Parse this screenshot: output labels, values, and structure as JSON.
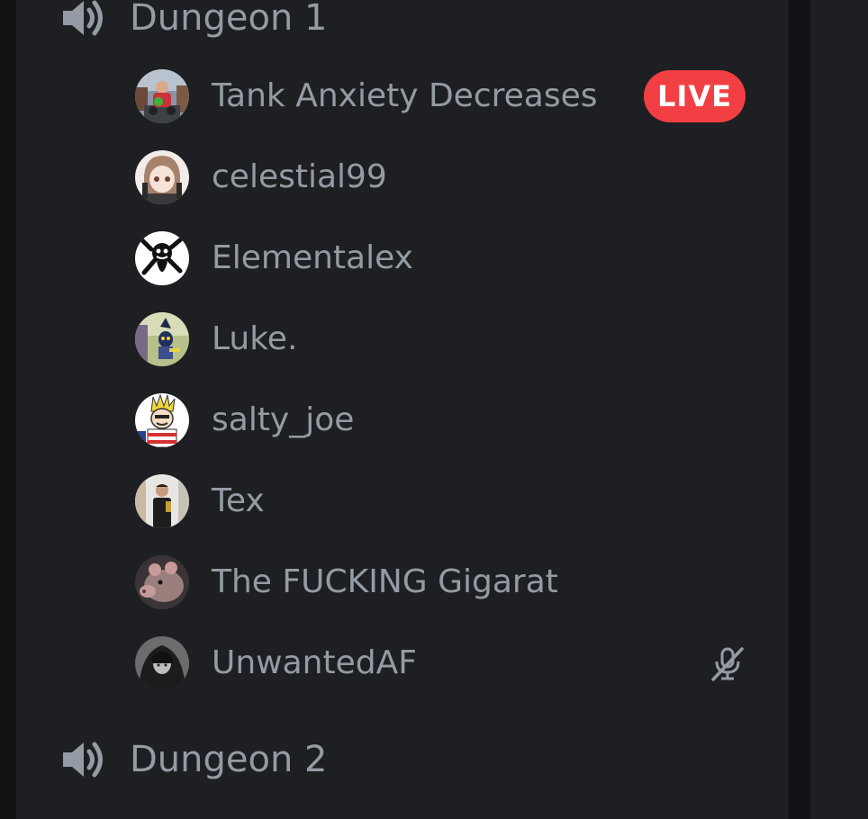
{
  "channels": [
    {
      "name": "Dungeon 1",
      "icon": "speaker-icon",
      "members": [
        {
          "name": "Tank Anxiety Decreases",
          "status": "LIVE",
          "avatar": "photo-avatar"
        },
        {
          "name": "celestial99",
          "avatar": "anime-girl-avatar"
        },
        {
          "name": "Elementalex",
          "avatar": "black-white-avatar"
        },
        {
          "name": "Luke.",
          "avatar": "game-character-avatar"
        },
        {
          "name": "salty_joe",
          "avatar": "cartoon-avatar"
        },
        {
          "name": "Tex",
          "avatar": "person-photo-avatar"
        },
        {
          "name": "The FUCKING Gigarat",
          "avatar": "rat-avatar"
        },
        {
          "name": "UnwantedAF",
          "avatar": "dark-hooded-avatar",
          "muted_icon": "microphone-muted-icon"
        }
      ]
    },
    {
      "name": "Dungeon 2",
      "icon": "speaker-icon",
      "members": []
    }
  ],
  "colors": {
    "background": "#111214",
    "panel": "#1e1f22",
    "text": "#949ba4",
    "live_badge": "#f23f43"
  }
}
